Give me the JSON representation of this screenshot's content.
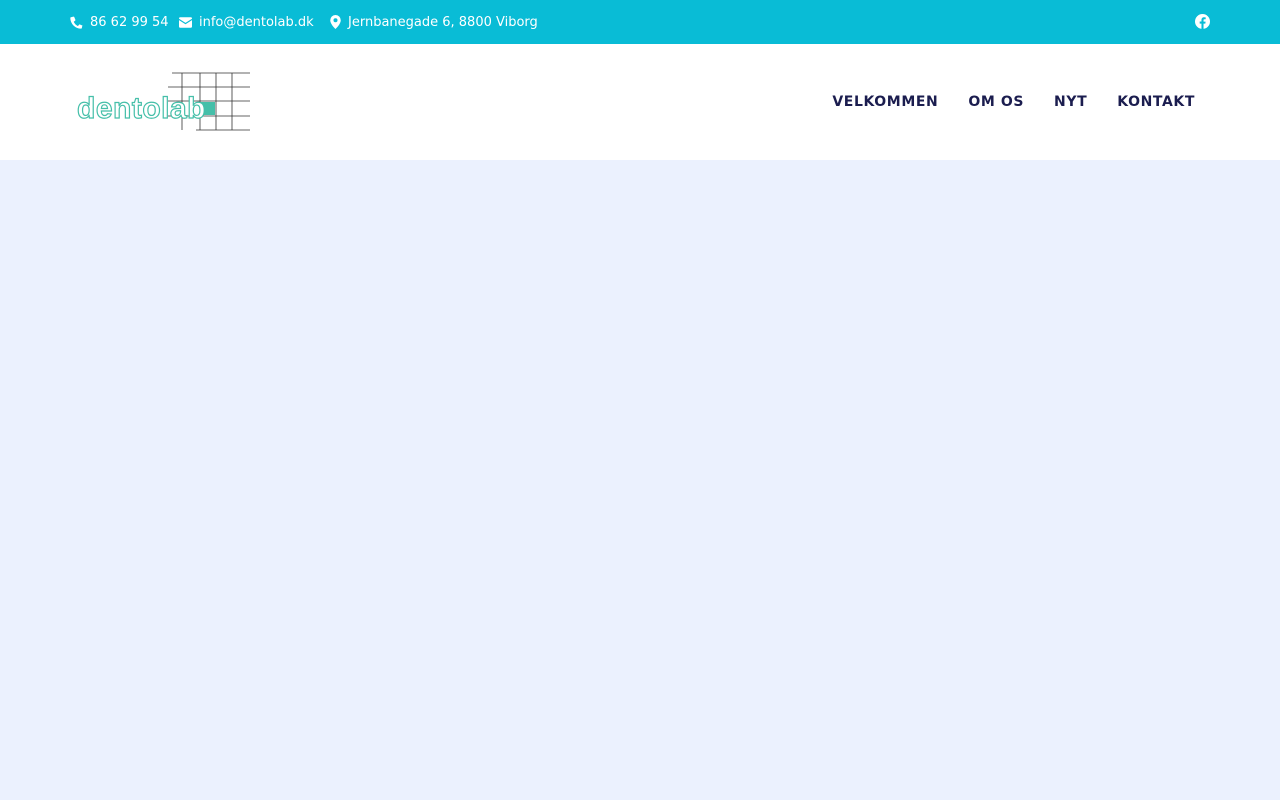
{
  "topbar": {
    "phone": {
      "icon": "phone-icon",
      "text": "86 62 99 54"
    },
    "email": {
      "icon": "envelope-icon",
      "text": "info@dentolab.dk"
    },
    "address": {
      "icon": "map-marker-icon",
      "text": "Jernbanegade 6, 8800 Viborg"
    },
    "social": {
      "icon": "facebook-icon"
    },
    "background_color": "#09bcd6"
  },
  "header": {
    "logo_text": "dentolab",
    "nav": [
      {
        "label": "VELKOMMEN"
      },
      {
        "label": "OM OS"
      },
      {
        "label": "NYT"
      },
      {
        "label": "KONTAKT"
      }
    ]
  },
  "colors": {
    "nav_text": "#1b1d4f",
    "page_background": "#ebf1fe",
    "logo_teal": "#45bfa9"
  }
}
